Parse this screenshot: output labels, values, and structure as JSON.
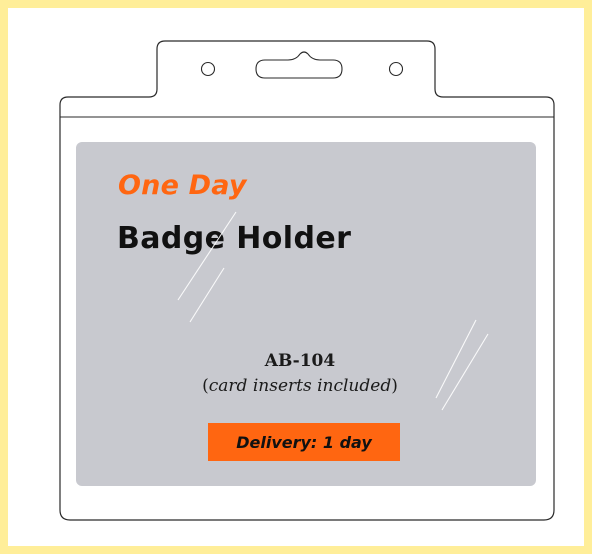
{
  "product": {
    "headline_top": "One Day",
    "headline_main": "Badge Holder",
    "model": "AB-104",
    "note_open": "(",
    "note_text": "card inserts included",
    "note_close": ")",
    "delivery": "Delivery: 1 day"
  },
  "colors": {
    "page_border": "#ffee99",
    "insert_gray": "#c8c9cf",
    "accent_orange": "#ff6611",
    "text_dark": "#111111"
  },
  "icons": {
    "slot": "slot-hole-icon",
    "hole_left": "round-hole-icon",
    "hole_right": "round-hole-icon"
  }
}
